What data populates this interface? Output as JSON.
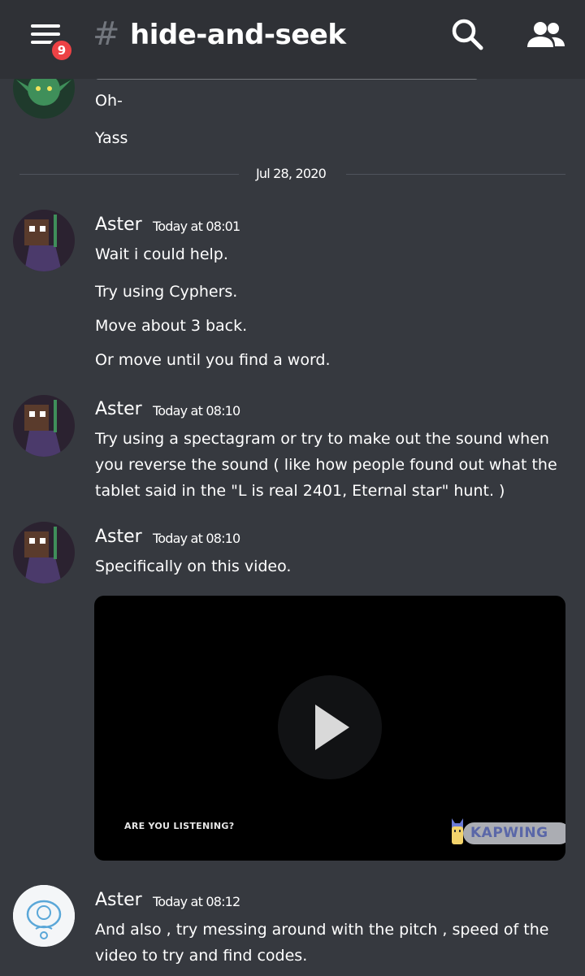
{
  "header": {
    "notification_count": "9",
    "hash_symbol": "#",
    "channel_name": "hide-and-seek"
  },
  "messages_top": {
    "line1": "Oh-",
    "line2": "Yass"
  },
  "date_divider": "Jul 28, 2020",
  "groups": [
    {
      "author": "Aster",
      "timestamp": "Today at 08:01",
      "lines": [
        "Wait i could help.",
        "Try using Cyphers.",
        "Move about 3 back.",
        "Or move until you find a word."
      ]
    },
    {
      "author": "Aster",
      "timestamp": "Today at 08:10",
      "lines": [
        "Try using a spectagram or try to make out the sound when you reverse the sound ( like how people found out what the tablet said in the \"L is real 2401, Eternal star\" hunt. )"
      ]
    },
    {
      "author": "Aster",
      "timestamp": "Today at 08:10",
      "lines": [
        "Specifically on this video."
      ]
    },
    {
      "author": "Aster",
      "timestamp": "Today at 08:12",
      "lines": [
        "And also , try messing around with the pitch , speed of the video to try and find codes."
      ]
    }
  ],
  "video": {
    "caption": "ARE YOU LISTENING?",
    "watermark": "KAPWING"
  },
  "colors": {
    "background": "#36393f",
    "topbar": "#2f3136",
    "badge": "#ed4245"
  }
}
